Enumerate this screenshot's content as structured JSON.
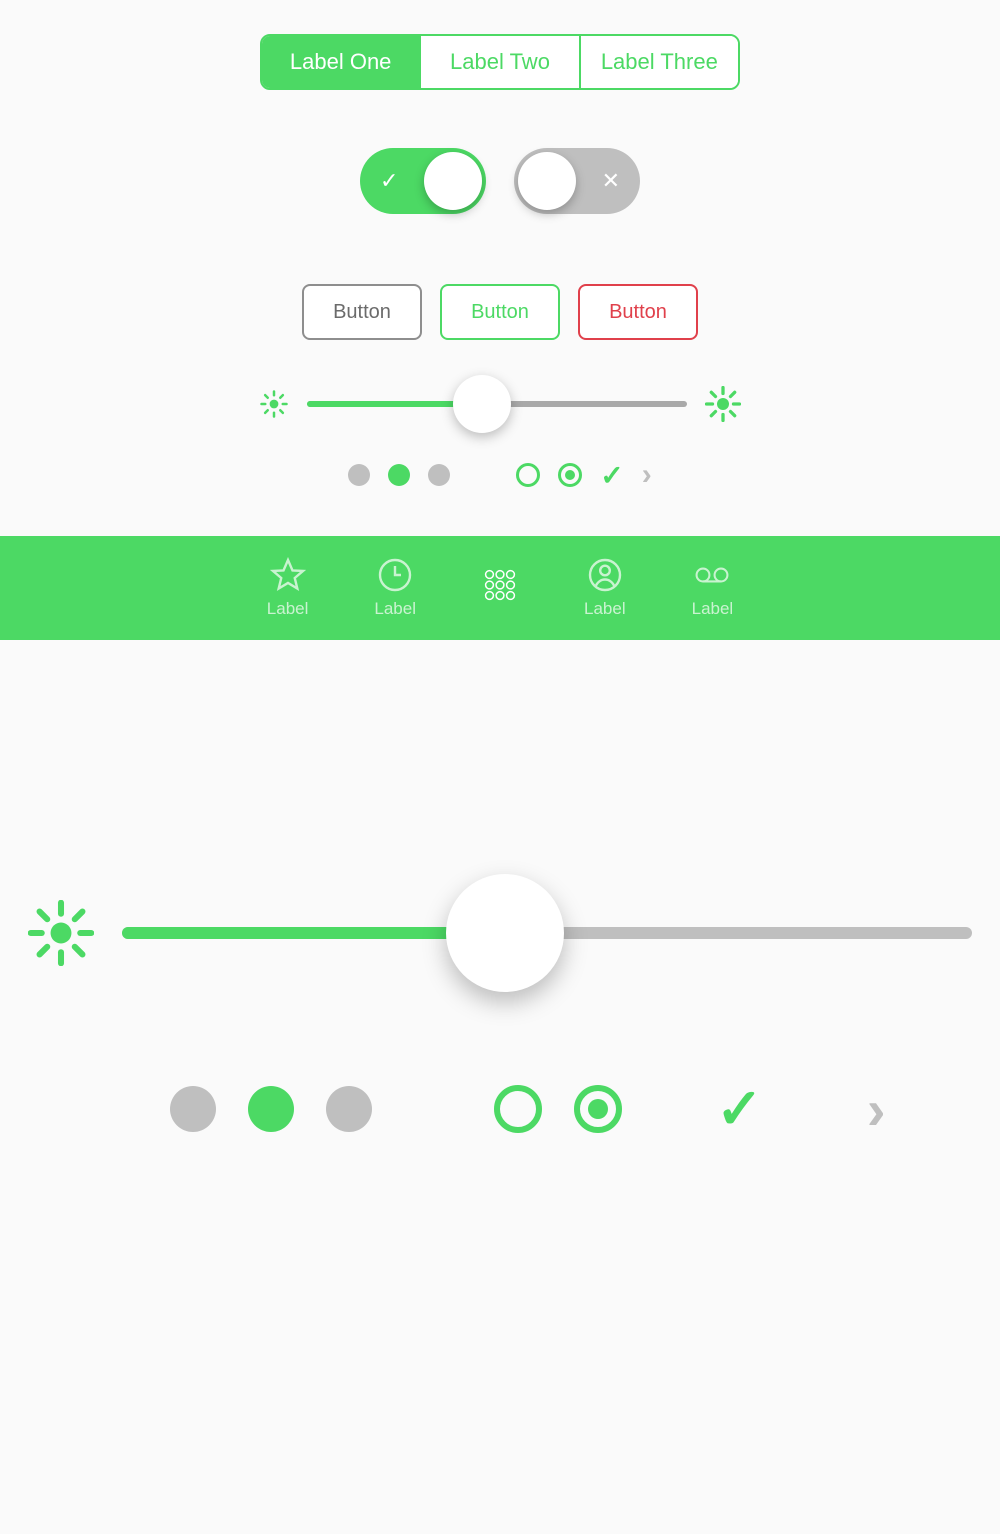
{
  "colors": {
    "green": "#4cd964",
    "gray": "#a9a9a9",
    "gray_light": "#bfbfbf",
    "red": "#e0404b"
  },
  "segmented": {
    "items": [
      {
        "label": "Label One",
        "active": true
      },
      {
        "label": "Label Two",
        "active": false
      },
      {
        "label": "Label Three",
        "active": false
      }
    ]
  },
  "toggles": {
    "on": {
      "state": "on",
      "mark": "✓"
    },
    "off": {
      "state": "off",
      "mark": "✕"
    }
  },
  "buttons": {
    "gray": {
      "label": "Button"
    },
    "green": {
      "label": "Button"
    },
    "red": {
      "label": "Button"
    }
  },
  "slider_small": {
    "value_percent": 46
  },
  "indicator_row_small": {
    "page_dots": [
      "gray",
      "green",
      "gray"
    ],
    "radio_empty": true,
    "radio_selected": true,
    "check": true,
    "chevron": true
  },
  "tabbar": {
    "items": [
      {
        "icon": "star-icon",
        "label": "Label"
      },
      {
        "icon": "clock-icon",
        "label": "Label"
      },
      {
        "icon": "grid-icon",
        "label": ""
      },
      {
        "icon": "user-icon",
        "label": "Label"
      },
      {
        "icon": "voicemail-icon",
        "label": "Label"
      }
    ]
  },
  "slider_large": {
    "value_percent": 45
  },
  "indicator_row_large": {
    "page_dots": [
      "gray",
      "green",
      "gray"
    ],
    "radio_empty": true,
    "radio_selected": true,
    "check": true,
    "chevron": true
  }
}
